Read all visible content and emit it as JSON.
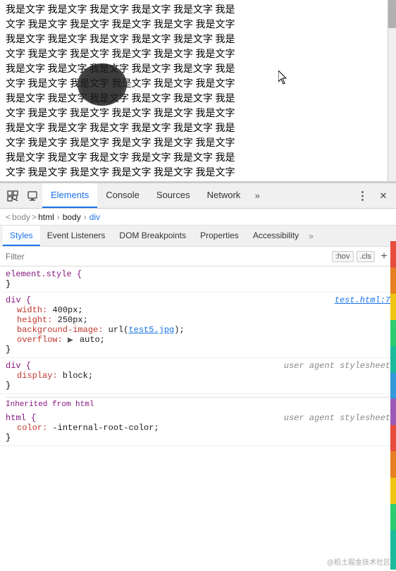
{
  "viewport": {
    "text_content": "我是文字 我是文字 我是文字 我是文字 我是文字 我是文字 我是文字 我是文字 我是文字 我是文字 我是文字 我是文字 我是文字 我是文字 我是文字 我是文字 我是文字 我是文字 我是文字 我是文字 我是文字 我是文字 我是文字 我是文字 我是文字 我是文字 我是文字 我是文字 我是文字 我是文字 我是文字 我是文字 我是文字 我是文字 我是文字 我是文字 我是文字 我是文字 我是文字 我是文字 我是文字 我是文字 我是文字 我是文字 我是文字 我是文字 我是文字 我是文字 我是文字 我是文字 我是文字 我是文字 我是文字 我是文字 我是文字 我是文字 我是文字 我是文字 我是文字 我是文字 我是文字 我是文字 我是文字 我是文字 我是文字 我是文字 我是文字 我是文字 我是文字 我是文字 我是文字 我是文字 我是文字 我是文字 我是文字 我是文字 我是文字 我是文字 我是文字 我是文字 我是文字 我是文字 我是文字 我是文字 我是文字 我是文字 我是文字 我是文字 我是文字 我是文字 我是文字 我是文字 我是文字 我是文字 我是文字 我是文字 我是文字 我是文字 我是文字 我是文字"
  },
  "devtools": {
    "toolbar": {
      "inspect_icon": "⊡",
      "device_icon": "⬜",
      "tabs": [
        "Elements",
        "Console",
        "Sources",
        "Network"
      ],
      "more_label": "»",
      "dots_icon": "⋮",
      "close_icon": "✕"
    },
    "breadcrumb": {
      "items": [
        "html",
        "body",
        "div"
      ]
    },
    "styles_tabs": [
      "Styles",
      "Event Listeners",
      "DOM Breakpoints",
      "Properties",
      "Accessibility"
    ],
    "filter": {
      "placeholder": "Filter",
      "hov_label": ":hov",
      "cls_label": ".cls",
      "plus_label": "+"
    },
    "css_rules": [
      {
        "id": "element-style",
        "selector": "element.style",
        "origin": "",
        "properties": [],
        "close": "}"
      },
      {
        "id": "div-rule",
        "selector": "div",
        "origin": "test.html:7",
        "properties": [
          {
            "prop": "width:",
            "value": "400px;"
          },
          {
            "prop": "height:",
            "value": "250px;"
          },
          {
            "prop": "background-image:",
            "value_prefix": "url(",
            "value_link": "test5.jpg",
            "value_suffix": ");"
          },
          {
            "prop": "overflow:",
            "value_arrow": "▶",
            "value": " auto;"
          }
        ],
        "close": "}"
      },
      {
        "id": "div-ua",
        "selector": "div",
        "origin": "user agent stylesheet",
        "properties": [
          {
            "prop": "display:",
            "value": "block;"
          }
        ],
        "close": "}"
      },
      {
        "id": "inherited-from",
        "label": "Inherited from",
        "tag": "html"
      },
      {
        "id": "html-ua",
        "selector": "html",
        "origin": "user agent stylesheet",
        "properties": [
          {
            "prop": "color:",
            "value": "-internal-root-color;"
          }
        ],
        "close": "}"
      }
    ],
    "watermark": "@稻土掘金技术社区"
  }
}
